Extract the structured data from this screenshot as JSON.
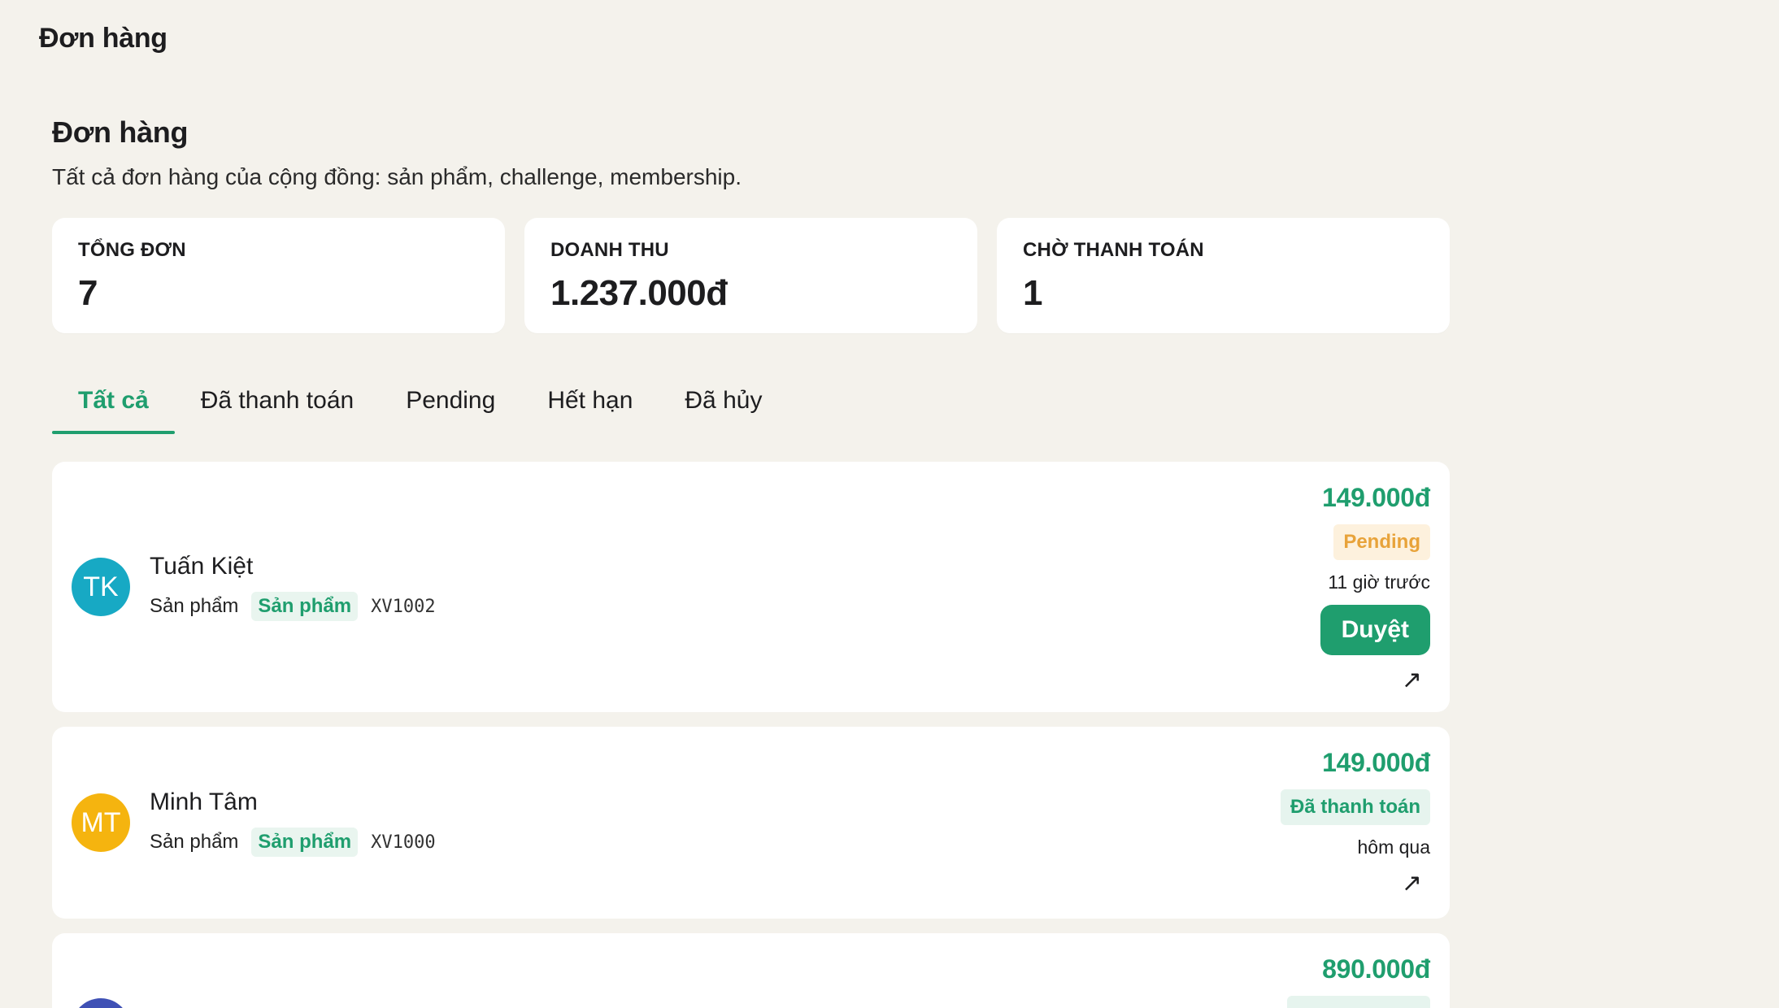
{
  "window": {
    "title": "Đơn hàng"
  },
  "page": {
    "title": "Đơn hàng",
    "subtitle": "Tất cả đơn hàng của cộng đồng: sản phẩm, challenge, membership."
  },
  "stats": [
    {
      "label": "TỔNG ĐƠN",
      "value": "7"
    },
    {
      "label": "DOANH THU",
      "value": "1.237.000đ"
    },
    {
      "label": "CHỜ THANH TOÁN",
      "value": "1"
    }
  ],
  "tabs": [
    {
      "label": "Tất cả",
      "active": true
    },
    {
      "label": "Đã thanh toán",
      "active": false
    },
    {
      "label": "Pending",
      "active": false
    },
    {
      "label": "Hết hạn",
      "active": false
    },
    {
      "label": "Đã hủy",
      "active": false
    }
  ],
  "orders": [
    {
      "initials": "TK",
      "avatar_color": "#17a9c4",
      "name": "Tuấn Kiệt",
      "type": "Sản phẩm",
      "chip": "Sản phẩm",
      "code": "XV1002",
      "amount": "149.000đ",
      "status": "Pending",
      "status_kind": "pending",
      "time": "11 giờ trước",
      "action": "Duyệt",
      "open_icon": "arrow-up-right-icon",
      "open_symbol": "↗"
    },
    {
      "initials": "MT",
      "avatar_color": "#f5b40f",
      "name": "Minh Tâm",
      "type": "Sản phẩm",
      "chip": "Sản phẩm",
      "code": "XV1000",
      "amount": "149.000đ",
      "status": "Đã thanh toán",
      "status_kind": "paid",
      "time": "hôm qua",
      "open_icon": "arrow-up-right-icon",
      "open_symbol": "↗"
    },
    {
      "avatar_color": "#3f51b5",
      "amount": "890.000đ",
      "status_kind": "paid"
    }
  ],
  "colors": {
    "accent": "#1f9e6e",
    "pending": "#e8a33a",
    "background": "#f4f2ec"
  }
}
